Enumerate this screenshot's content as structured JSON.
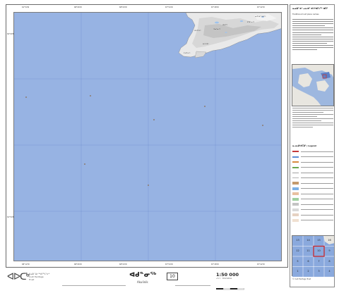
{
  "map": {
    "ticks_top": [
      "61°54'N",
      "68°06'W",
      "68°00'W",
      "67°54'W",
      "67°48'W",
      "67°42'W"
    ],
    "ticks_bottom": [
      "68°12'W",
      "68°06'W",
      "68°00'W",
      "67°54'W",
      "67°48'W",
      "67°42'W"
    ],
    "ticks_side": [
      "62°00'N",
      "61°54'N"
    ],
    "place_labels": [
      "ᐊᓯᐊᕐᔪᒃ",
      "ᑐᓄᓐᓂᖅ",
      "ᐊᒪᕈᖅ",
      "ᑭᖑᓪᓕᖅ",
      "ᐃᑦᓯᕐᕕᒃ",
      "ᑕᓯᐅᔭᖅ",
      "ᓂᐊᖁᓐᖑᐊᖅ"
    ]
  },
  "sidebar": {
    "title": "ᓇᓄᐃᑦ ᐅᓪᓗᕆᐊᑦ ᐊᒃᓱᐊᕈᓯᖅ ᐊᑏᑦ",
    "subtitle": "Traditional Inuit place names"
  },
  "legend": {
    "title": "ᓇᓗᓇᐃᒃᑯᑕᐃᑦ | Legend",
    "symbol_colors": [
      "#c43a3a",
      "#5c8fd6",
      "#d88b3f",
      "#6aa84f",
      "#a3a3a3",
      "#b4b4b4",
      "#c49a6c",
      "#7bb0e6",
      "#e8c0a0",
      "#9fd0a0",
      "#c4c4c4",
      "#d9d9d9"
    ]
  },
  "index": {
    "cells": [
      "13",
      "14",
      "15",
      "16",
      "12",
      "11",
      "10",
      "9",
      "5",
      "6",
      "7",
      "8",
      "1",
      "2",
      "3",
      "4"
    ],
    "selected": "10"
  },
  "footer": {
    "logo_glyph": "ᐊᐅᑕᒃ",
    "org_line1": "ᐃᓄᐃᑦ ᐃᓕᖅᑯᓯᖓᓐᓂᒃ",
    "org_line2": "Inuit Heritage",
    "org_line3": "Trust",
    "sheet_title": "ᐊᑯᓐᓂᖅ",
    "sheet_no": "10",
    "sheet_sub": "Akulinik",
    "scale": "1:50 000",
    "scale_sub": "ᓯᑎᒥᑕ · Kilometres",
    "copyright": "© Inuit Heritage Trust"
  }
}
